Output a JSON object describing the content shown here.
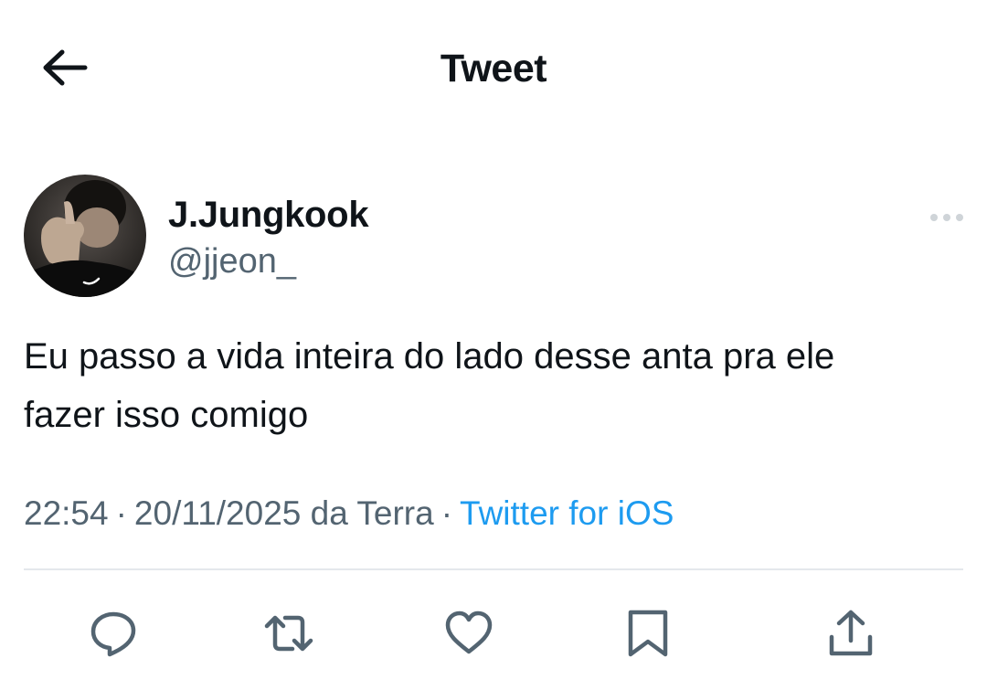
{
  "header": {
    "title": "Tweet",
    "back_icon": "arrow-left-icon"
  },
  "tweet": {
    "author": {
      "display_name": "J.Jungkook",
      "handle": "@jjeon_"
    },
    "text_line1": "Eu passo a vida inteira do lado desse anta pra ele",
    "text_line2": "fazer isso comigo",
    "meta": {
      "time": "22:54",
      "separator": "·",
      "date_location": "20/11/2025 da Terra",
      "source": "Twitter for iOS"
    }
  },
  "actions": [
    {
      "name": "reply",
      "icon": "comment-icon"
    },
    {
      "name": "retweet",
      "icon": "retweet-icon"
    },
    {
      "name": "like",
      "icon": "heart-icon"
    },
    {
      "name": "bookmark",
      "icon": "bookmark-icon"
    },
    {
      "name": "share",
      "icon": "share-icon"
    }
  ],
  "colors": {
    "text": "#0f1419",
    "secondary": "#536471",
    "link": "#1d9bf0",
    "divider": "#e4e8ec",
    "icon": "#536471"
  }
}
